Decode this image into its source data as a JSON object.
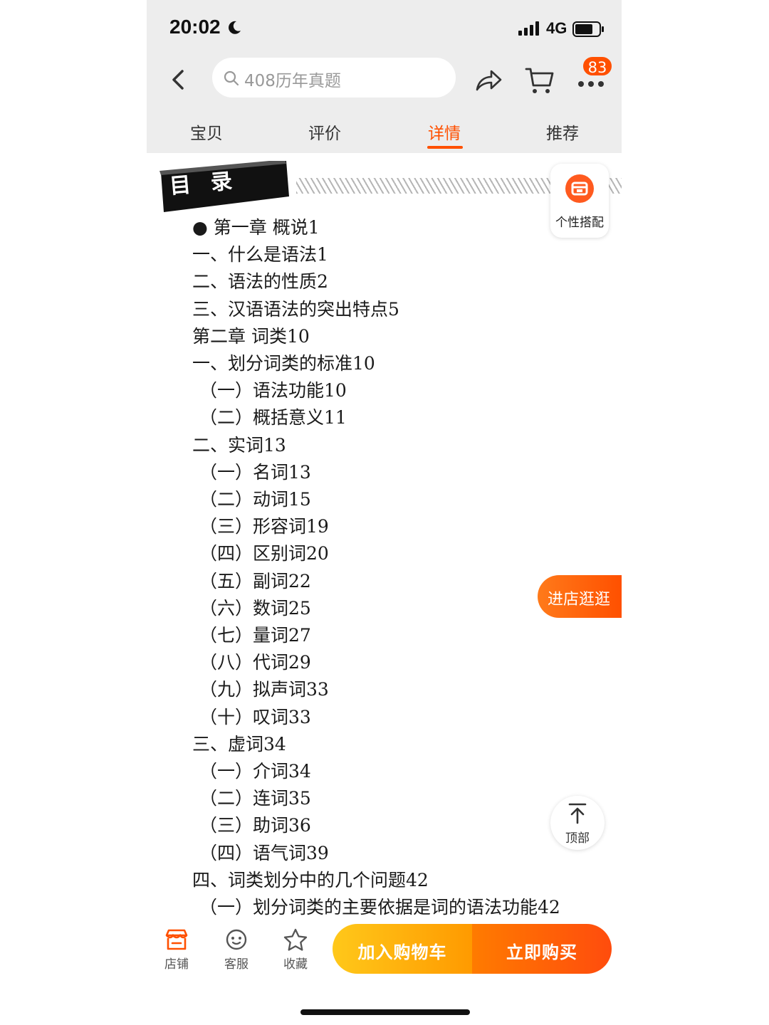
{
  "status_bar": {
    "time": "20:02",
    "network": "4G"
  },
  "search": {
    "query": "408历年真题"
  },
  "cart_badge": "83",
  "tabs": [
    {
      "label": "宝贝",
      "active": false
    },
    {
      "label": "评价",
      "active": false
    },
    {
      "label": "详情",
      "active": true
    },
    {
      "label": "推荐",
      "active": false
    }
  ],
  "toc": {
    "title": "目录",
    "items": [
      "●  第一章 概说1",
      "一、什么是语法1",
      "二、语法的性质2",
      "三、汉语语法的突出特点5",
      "第二章 词类10",
      "一、划分词类的标准10",
      "（一）语法功能10",
      "（二）概括意义11",
      "二、实词13",
      "（一）名词13",
      "（二）动词15",
      "（三）形容词19",
      "（四）区别词20",
      "（五）副词22",
      "（六）数词25",
      "（七）量词27",
      "（八）代词29",
      "（九）拟声词33",
      "（十）叹词33",
      "三、虚词34",
      "（一）介词34",
      "（二）连词35",
      "（三）助词36",
      "（四）语气词39",
      "四、词类划分中的几个问题42",
      "（一）划分词类的主要依据是词的语法功能42"
    ]
  },
  "floating": {
    "match_label": "个性搭配",
    "visit_store_label": "进店逛逛",
    "top_label": "顶部"
  },
  "bottom_bar": {
    "store_label": "店铺",
    "service_label": "客服",
    "favorite_label": "收藏",
    "add_cart_label": "加入购物车",
    "buy_now_label": "立即购买"
  },
  "colors": {
    "accent": "#ff5000",
    "cart_button": "#ffb000",
    "header_bg": "#ededed"
  },
  "icons": [
    "moon-icon",
    "signal-icon",
    "battery-icon",
    "back-icon",
    "search-icon",
    "share-icon",
    "cart-icon",
    "more-icon",
    "match-icon",
    "to-top-icon",
    "store-icon",
    "service-icon",
    "star-icon"
  ]
}
